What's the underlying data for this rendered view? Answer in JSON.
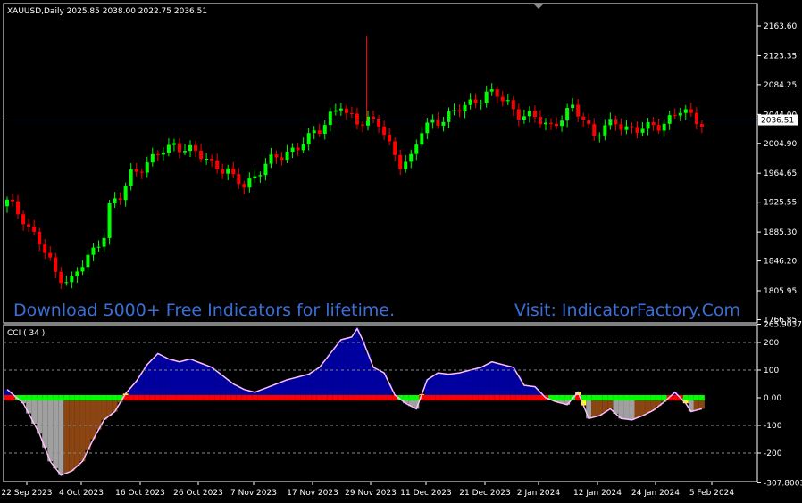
{
  "symbol_info": "XAUUSD,Daily  2025.85 2038.00 2022.75 2036.51",
  "price_axis": {
    "labels": [
      "2163.60",
      "2123.35",
      "2084.25",
      "2044.00",
      "2004.90",
      "1964.65",
      "1925.55",
      "1885.30",
      "1846.20",
      "1805.95",
      "1766.85"
    ],
    "current_price_label": "2036.51",
    "current_price": 2036.51
  },
  "banner": {
    "left": "Download 5000+ Free Indicators for lifetime.",
    "right": "Visit: IndicatorFactory.Com"
  },
  "indicator": {
    "label": "CCI  ( 34 )",
    "axis_labels": [
      "265.9037",
      "200",
      "100",
      "0.00",
      "-100",
      "-200",
      "-307.8003"
    ]
  },
  "date_axis": {
    "labels": [
      "22 Sep 2023",
      "4 Oct 2023",
      "16 Oct 2023",
      "26 Oct 2023",
      "7 Nov 2023",
      "17 Nov 2023",
      "29 Nov 2023",
      "11 Dec 2023",
      "21 Dec 2023",
      "2 Jan 2024",
      "12 Jan 2024",
      "24 Jan 2024",
      "5 Feb 2024"
    ]
  },
  "colors": {
    "background": "#000000",
    "bull": "#00ff00",
    "bear": "#ff0000",
    "cci_pos": "#0000a0",
    "cci_neg_fall": "#8b4513",
    "cci_neg_gray": "#a0a0a0",
    "cci_cross": "#ffff00",
    "cci_line": "#ffc0ff",
    "banner_text": "#3b6fd8"
  }
}
